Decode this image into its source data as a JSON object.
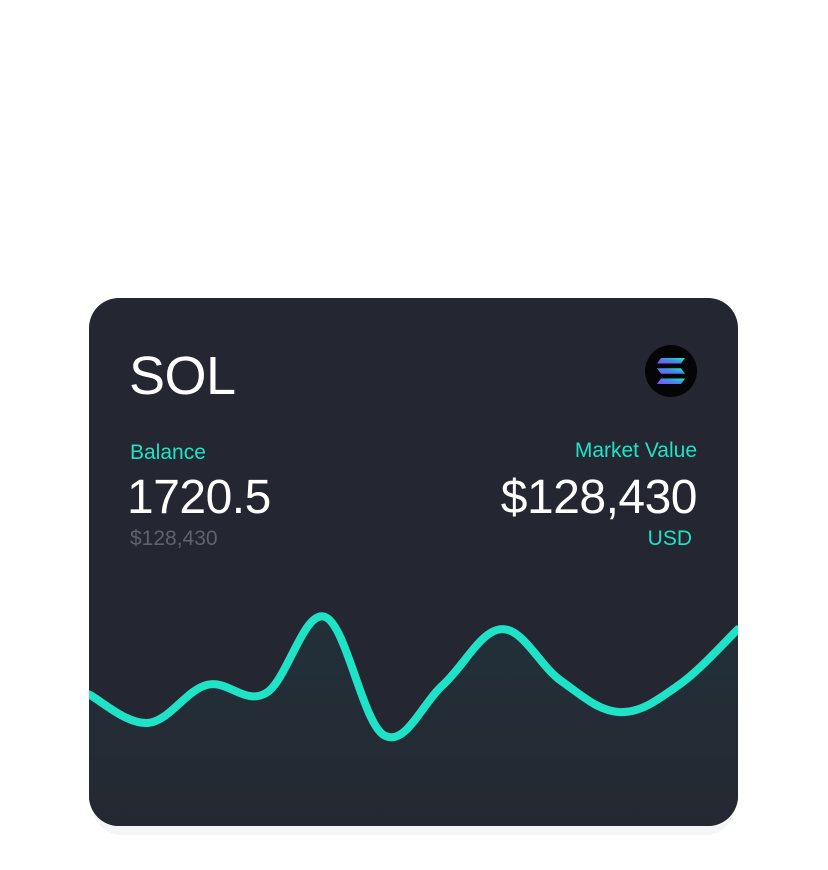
{
  "card": {
    "asset_symbol": "SOL",
    "logo_icon": "solana-logo-icon",
    "balance_label": "Balance",
    "balance_amount": "1720.5",
    "balance_fiat": "$128,430",
    "market_value_label": "Market Value",
    "market_value": "$128,430",
    "market_currency": "USD"
  },
  "colors": {
    "card_background": "#242631",
    "accent": "#1ee3c6",
    "muted_text": "#5f626e",
    "text": "#ffffff"
  },
  "chart_data": {
    "type": "area",
    "title": "",
    "xlabel": "",
    "ylabel": "",
    "series": [
      {
        "values": [
          0.35,
          0.14,
          0.42,
          0.36,
          0.92,
          0.05,
          0.42,
          0.83,
          0.45,
          0.22,
          0.42,
          0.83
        ]
      }
    ]
  }
}
